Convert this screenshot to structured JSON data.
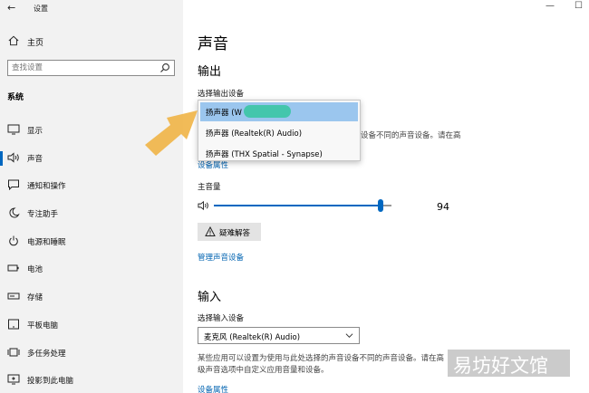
{
  "window": {
    "back_glyph": "←",
    "title": "设置",
    "minimize_glyph": "—",
    "maximize_glyph": "☐"
  },
  "sidebar": {
    "home_label": "主页",
    "search_placeholder": "查找设置",
    "section_title": "系统",
    "items": [
      {
        "label": "显示",
        "icon": "monitor-icon"
      },
      {
        "label": "声音",
        "icon": "speaker-icon",
        "active": true
      },
      {
        "label": "通知和操作",
        "icon": "notification-icon"
      },
      {
        "label": "专注助手",
        "icon": "moon-icon"
      },
      {
        "label": "电源和睡眠",
        "icon": "power-icon"
      },
      {
        "label": "电池",
        "icon": "battery-icon"
      },
      {
        "label": "存储",
        "icon": "storage-icon"
      },
      {
        "label": "平板电脑",
        "icon": "tablet-icon"
      },
      {
        "label": "多任务处理",
        "icon": "multitask-icon"
      },
      {
        "label": "投影到此电脑",
        "icon": "projector-icon"
      }
    ]
  },
  "main": {
    "page_title": "声音",
    "output": {
      "heading": "输出",
      "choose_device_label": "选择输出设备",
      "dropdown_options": [
        "扬声器 (W",
        "扬声器 (Realtek(R) Audio)",
        "扬声器 (THX Spatial - Synapse)"
      ],
      "selected_index": 0,
      "partial_description": "设备不同的声音设备。请在高",
      "device_properties_link": "设备属性",
      "master_volume_label": "主音量",
      "volume": 94,
      "volume_display": "94",
      "troubleshoot_label": "疑难解答",
      "manage_devices_link": "管理声音设备"
    },
    "input": {
      "heading": "输入",
      "choose_device_label": "选择输入设备",
      "selected_device": "麦克风 (Realtek(R) Audio)",
      "description_line1": "某些应用可以设置为使用与此处选择的声音设备不同的声音设备。请在高",
      "description_line2": "级声音选项中自定义应用音量和设备。",
      "device_properties_link": "设备属性"
    }
  },
  "overlay": {
    "watermark_text": "易坊好文馆",
    "arrow_color": "#f0b54a"
  },
  "colors": {
    "accent": "#0067c0",
    "link": "#0063b1",
    "selected_option": "#9bc6ee",
    "sidebar_bg": "#f2f2f2"
  }
}
